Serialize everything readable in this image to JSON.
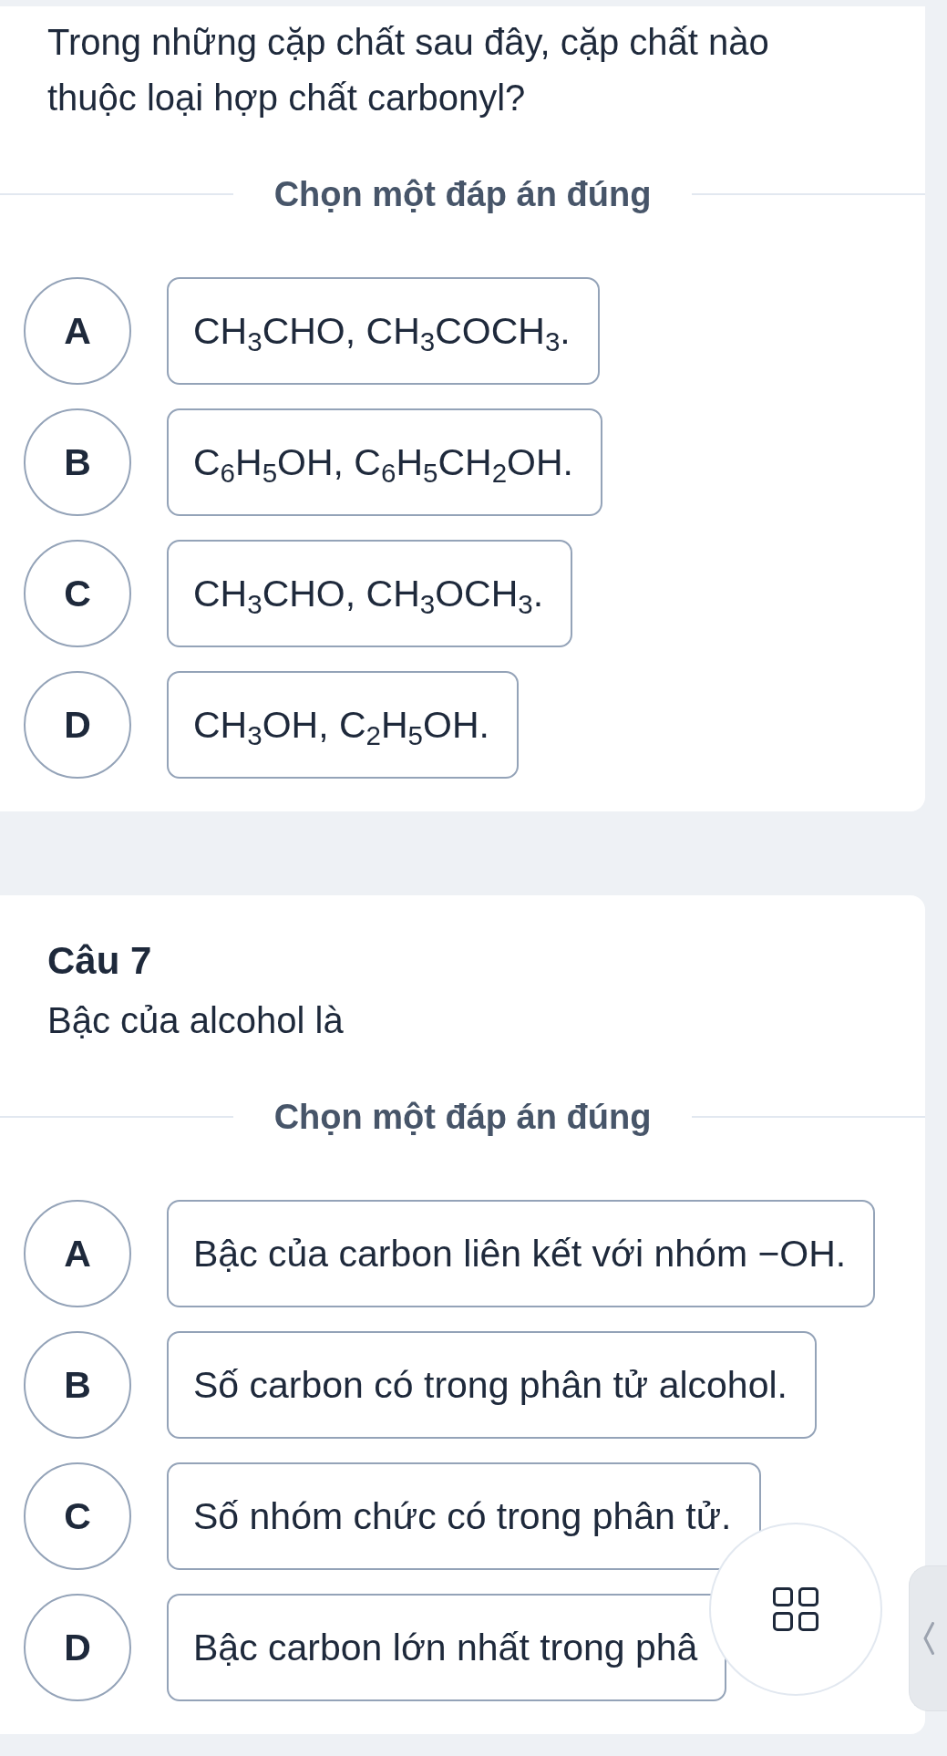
{
  "questions": [
    {
      "prompt": "Trong những cặp chất sau đây, cặp chất nào thuộc loại hợp chất carbonyl?",
      "instruction": "Chọn một đáp án đúng",
      "options": [
        {
          "letter": "A",
          "text": "CH$_{3}$CHO, CH$_{3}$COCH$_{3}$.",
          "selected": false
        },
        {
          "letter": "B",
          "text": "C$_{6}$H$_{5}$OH, C$_{6}$H$_{5}$CH$_{2}$OH.",
          "selected": false
        },
        {
          "letter": "C",
          "text": "CH$_{3}$CHO, CH$_{3}$OCH$_{3}$.",
          "selected": false
        },
        {
          "letter": "D",
          "text": "CH$_{3}$OH, C$_{2}$H$_{5}$OH.",
          "selected": false
        }
      ]
    },
    {
      "number": "Câu 7",
      "prompt": "Bậc của alcohol là",
      "instruction": "Chọn một đáp án đúng",
      "options": [
        {
          "letter": "A",
          "text": "Bậc của carbon liên kết với nhóm −OH.",
          "selected": false
        },
        {
          "letter": "B",
          "text": "Số carbon có trong phân tử alcohol.",
          "selected": false
        },
        {
          "letter": "C",
          "text": "Số nhóm chức có trong phân tử.",
          "selected": false
        },
        {
          "letter": "D",
          "text": "Bậc carbon lớn nhất trong phâ",
          "selected": false
        }
      ]
    }
  ]
}
